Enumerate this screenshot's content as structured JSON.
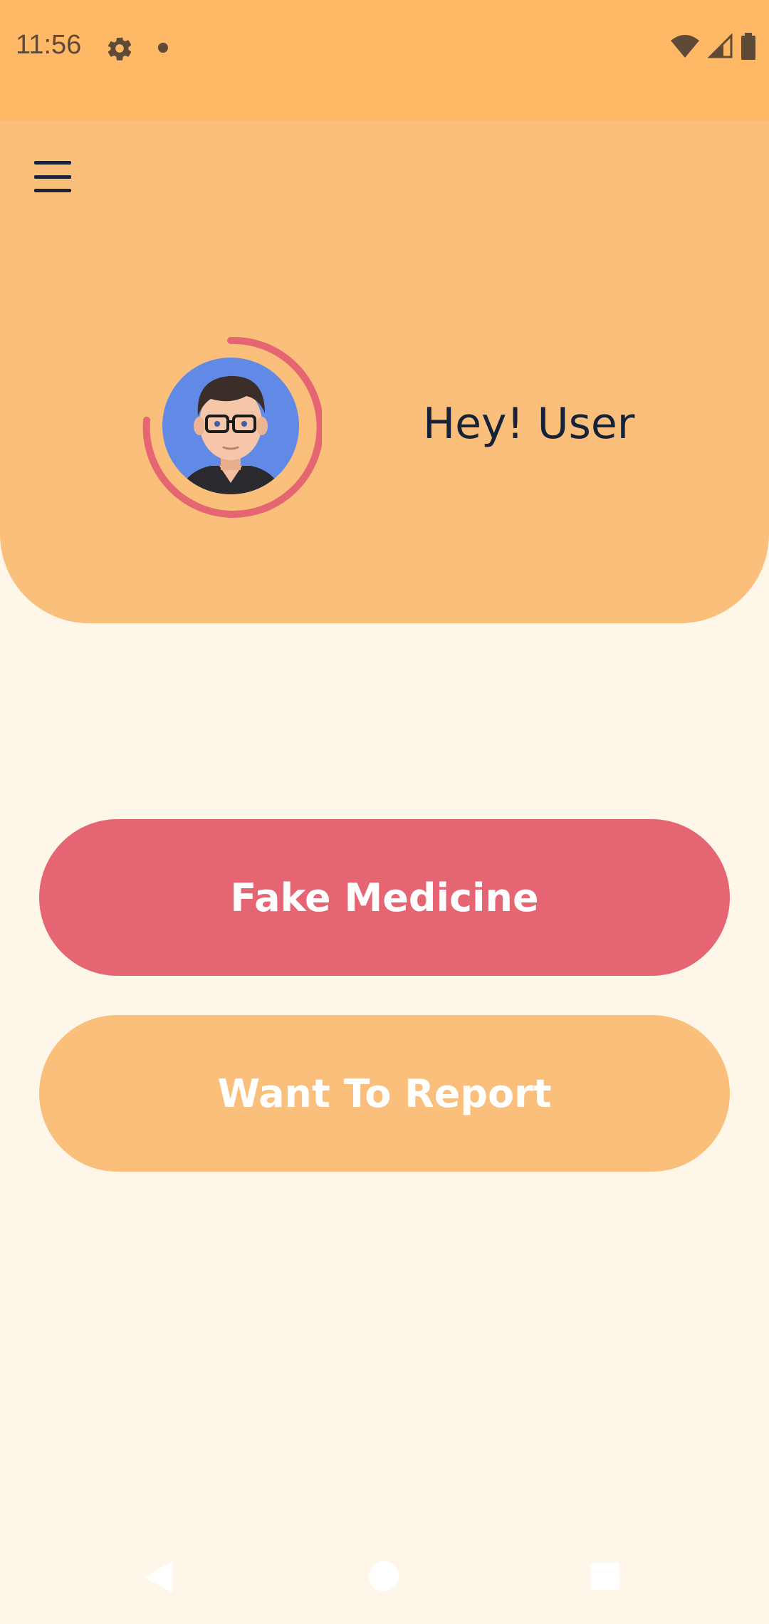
{
  "status_bar": {
    "time": "11:56",
    "icons": [
      "gear-icon",
      "notification-dot-icon",
      "wifi-icon",
      "signal-icon",
      "battery-icon"
    ]
  },
  "header": {
    "menu_icon": "hamburger-menu-icon",
    "greeting": "Hey! User",
    "avatar": "user-avatar"
  },
  "actions": {
    "fake_medicine_label": "Fake Medicine",
    "want_to_report_label": "Want To Report"
  },
  "navigation": {
    "icons": [
      "back-icon",
      "home-icon",
      "recent-apps-icon"
    ]
  },
  "colors": {
    "status_bar": "#FFB866",
    "header": "#F9BF7B",
    "background": "#FEF7E9",
    "primary_button": "#E56572",
    "secondary_button": "#F9BF7B",
    "text_dark": "#162237",
    "avatar_ring": "#E56572",
    "avatar_bg": "#6189E6"
  }
}
